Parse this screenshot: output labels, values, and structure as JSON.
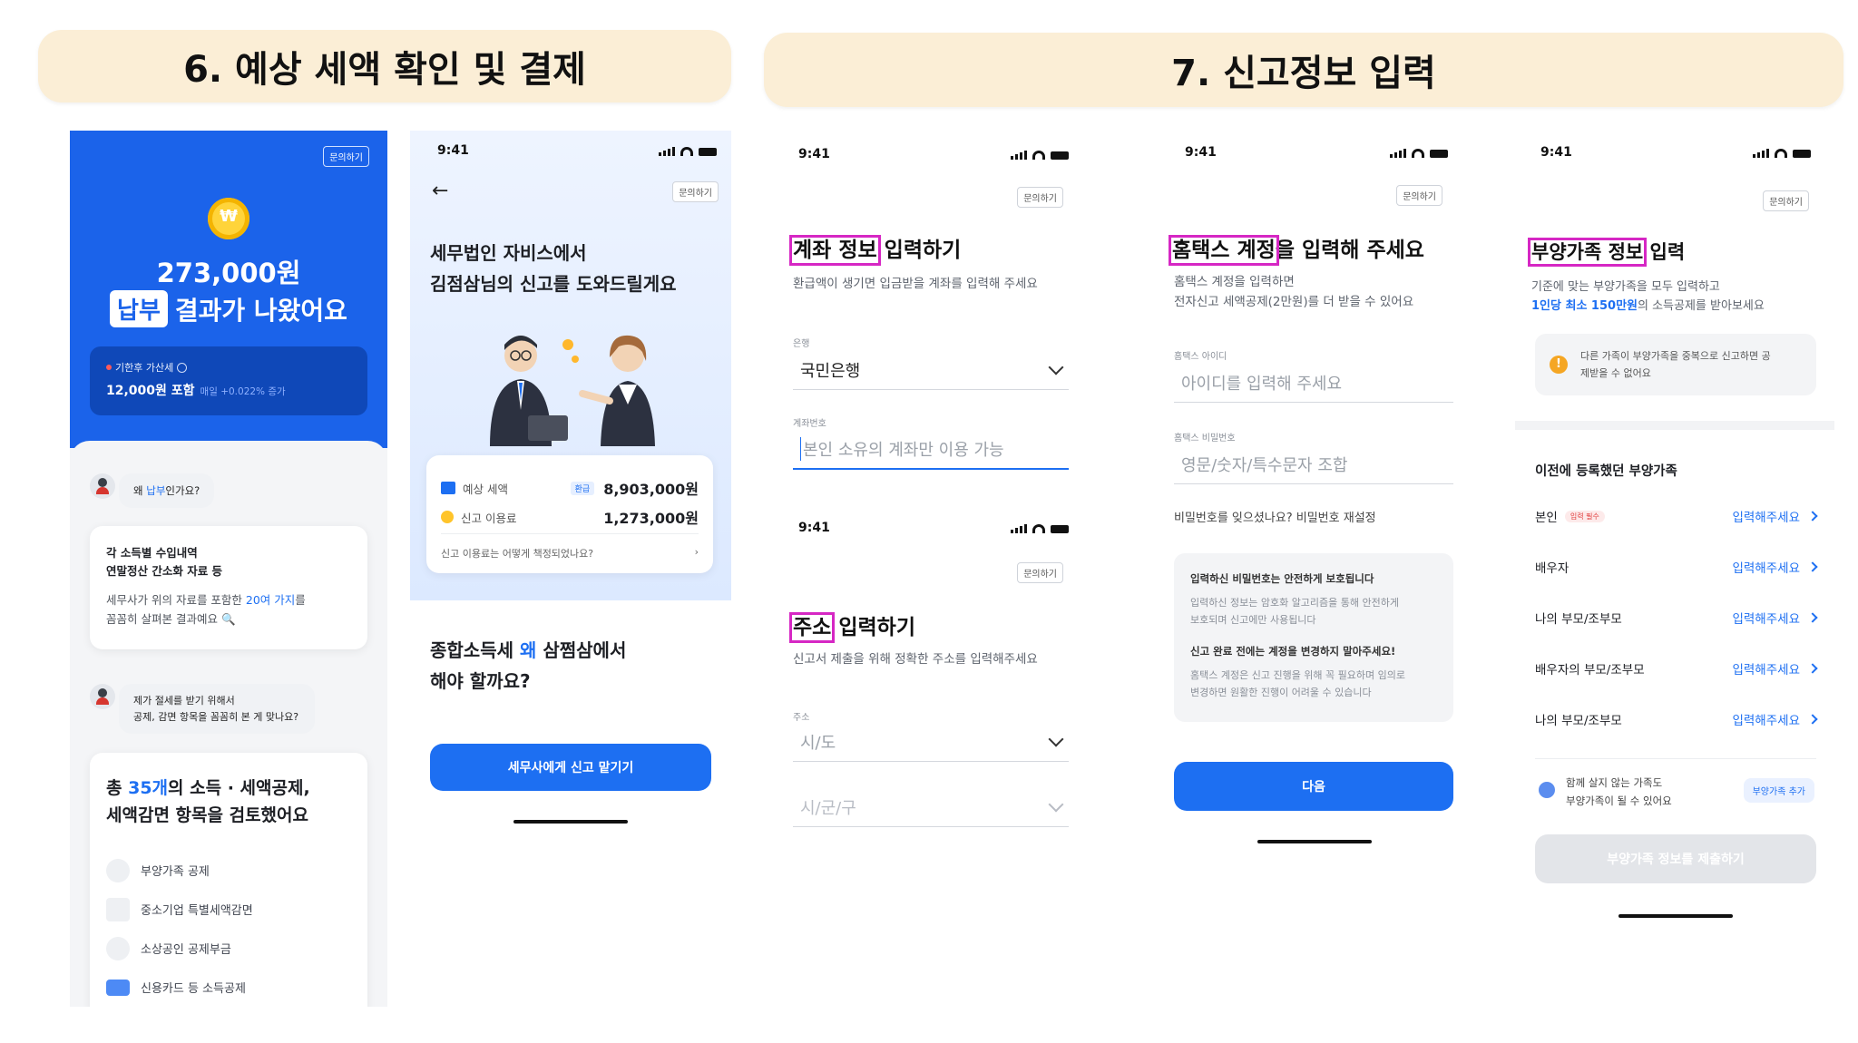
{
  "section6": {
    "title": "6. 예상 세액 확인 및 결제"
  },
  "section7": {
    "title": "7. 신고정보 입력"
  },
  "common": {
    "time": "9:41",
    "ask": "문의하기"
  },
  "s1": {
    "amount": "273,000원",
    "badge": "납부",
    "result_text": "결과가 나왔어요",
    "late_label": "기한후 가산세",
    "late_amount": "12,000원 포함",
    "late_daily": "매일 +0.022% 증가",
    "q1_prefix": "왜 ",
    "q1_hl": "납부",
    "q1_suffix": "인가요?",
    "card1_line1": "각 소득별 수입내역",
    "card1_line2": "연말정산 간소화 자료 등",
    "card1_body_a": "세무사가 위의 자료를 포함한 ",
    "card1_body_hl": "20여 가지",
    "card1_body_b": "를",
    "card1_body_c": "꼼꼼히 살펴본 결과예요",
    "q2_line1": "제가 절세를 받기 위해서",
    "q2_line2": "공제, 감면 항목을 꼼꼼히 본 게 맞나요?",
    "card2_a": "총 ",
    "card2_hl": "35개",
    "card2_b": "의 소득 · 세액공제,",
    "card2_line2": "세액감면 항목을 검토했어요",
    "deductions": [
      "부양가족 공제",
      "중소기업 특별세액감면",
      "소상공인 공제부금",
      "신용카드 등 소득공제"
    ]
  },
  "s2": {
    "heading_line1": "세무법인 자비스에서",
    "heading_line2": "김점삼님의 신고를 도와드릴게요",
    "fee_row1_label": "예상 세액",
    "fee_row1_tag": "환급",
    "fee_row1_value": "8,903,000원",
    "fee_row2_label": "신고 이용료",
    "fee_row2_value": "1,273,000원",
    "fee_link": "신고 이용료는 어떻게 책정되었나요?",
    "q_a": "종합소득세 ",
    "q_hl": "왜",
    "q_b": " 삼쩜삼에서",
    "q_line2": "해야 할까요?",
    "cta": "세무사에게 신고 맡기기"
  },
  "s3": {
    "title_hl": "계좌 정보",
    "title_rest": " 입력하기",
    "subtitle": "환급액이 생기면 입금받을 계좌를 입력해 주세요",
    "bank_label": "은행",
    "bank_value": "국민은행",
    "acct_label": "계좌번호",
    "acct_placeholder": "본인 소유의 계좌만 이용 가능"
  },
  "s4": {
    "title_hl": "주소",
    "title_rest": " 입력하기",
    "subtitle": "신고서 제출을 위해 정확한 주소를 입력해주세요",
    "addr_label": "주소",
    "city_placeholder": "시/도",
    "district_placeholder": "시/군/구"
  },
  "s5": {
    "title_hl": "홈택스 계정",
    "title_rest": "을 입력해 주세요",
    "sub1": "홈택스 계정을 입력하면",
    "sub2": "전자신고 세액공제(2만원)를 더 받을 수 있어요",
    "id_label": "홈택스 아이디",
    "id_placeholder": "아이디를 입력해 주세요",
    "pw_label": "홈택스 비밀번호",
    "pw_placeholder": "영문/숫자/특수문자 조합",
    "reset": "비밀번호를 잊으셨나요? 비밀번호 재설정",
    "info_title1": "입력하신 비밀번호는 안전하게 보호됩니다",
    "info_body1a": "입력하신 정보는 암호화 알고리즘을 통해 안전하게",
    "info_body1b": "보호되며 신고에만 사용됩니다",
    "info_title2": "신고 완료 전에는 계정을 변경하지 말아주세요!",
    "info_body2a": "홈택스 계정은 신고 진행을 위해 꼭 필요하며 임의로",
    "info_body2b": "변경하면 원활한 진행이 어려울 수 있습니다",
    "next": "다음"
  },
  "s6": {
    "title_hl": "부양가족 정보",
    "title_rest": " 입력",
    "sub1": "기준에 맞는 부양가족을 모두 입력하고",
    "sub2_hl": "1인당 최소 150만원",
    "sub2_rest": "의 소득공제를 받아보세요",
    "warn1": "다른 가족이 부양가족을 중복으로 신고하면 공",
    "warn2": "제받을 수 없어요",
    "list_title": "이전에 등록했던 부양가족",
    "rows": [
      {
        "label": "본인",
        "tag": "입력 필수",
        "link": "입력해주세요"
      },
      {
        "label": "배우자",
        "tag": "",
        "link": "입력해주세요"
      },
      {
        "label": "나의 부모/조부모",
        "tag": "",
        "link": "입력해주세요"
      },
      {
        "label": "배우자의 부모/조부모",
        "tag": "",
        "link": "입력해주세요"
      },
      {
        "label": "나의 부모/조부모",
        "tag": "",
        "link": "입력해주세요"
      }
    ],
    "extra1": "함께 살지 않는 가족도",
    "extra2": "부양가족이 될 수 있어요",
    "add_btn": "부양가족 추가",
    "submit": "부양가족 정보를 제출하기"
  },
  "colors": {
    "accent": "#1d6ff2",
    "header_bg": "#fbeed6",
    "highlight": "#d627c4"
  }
}
